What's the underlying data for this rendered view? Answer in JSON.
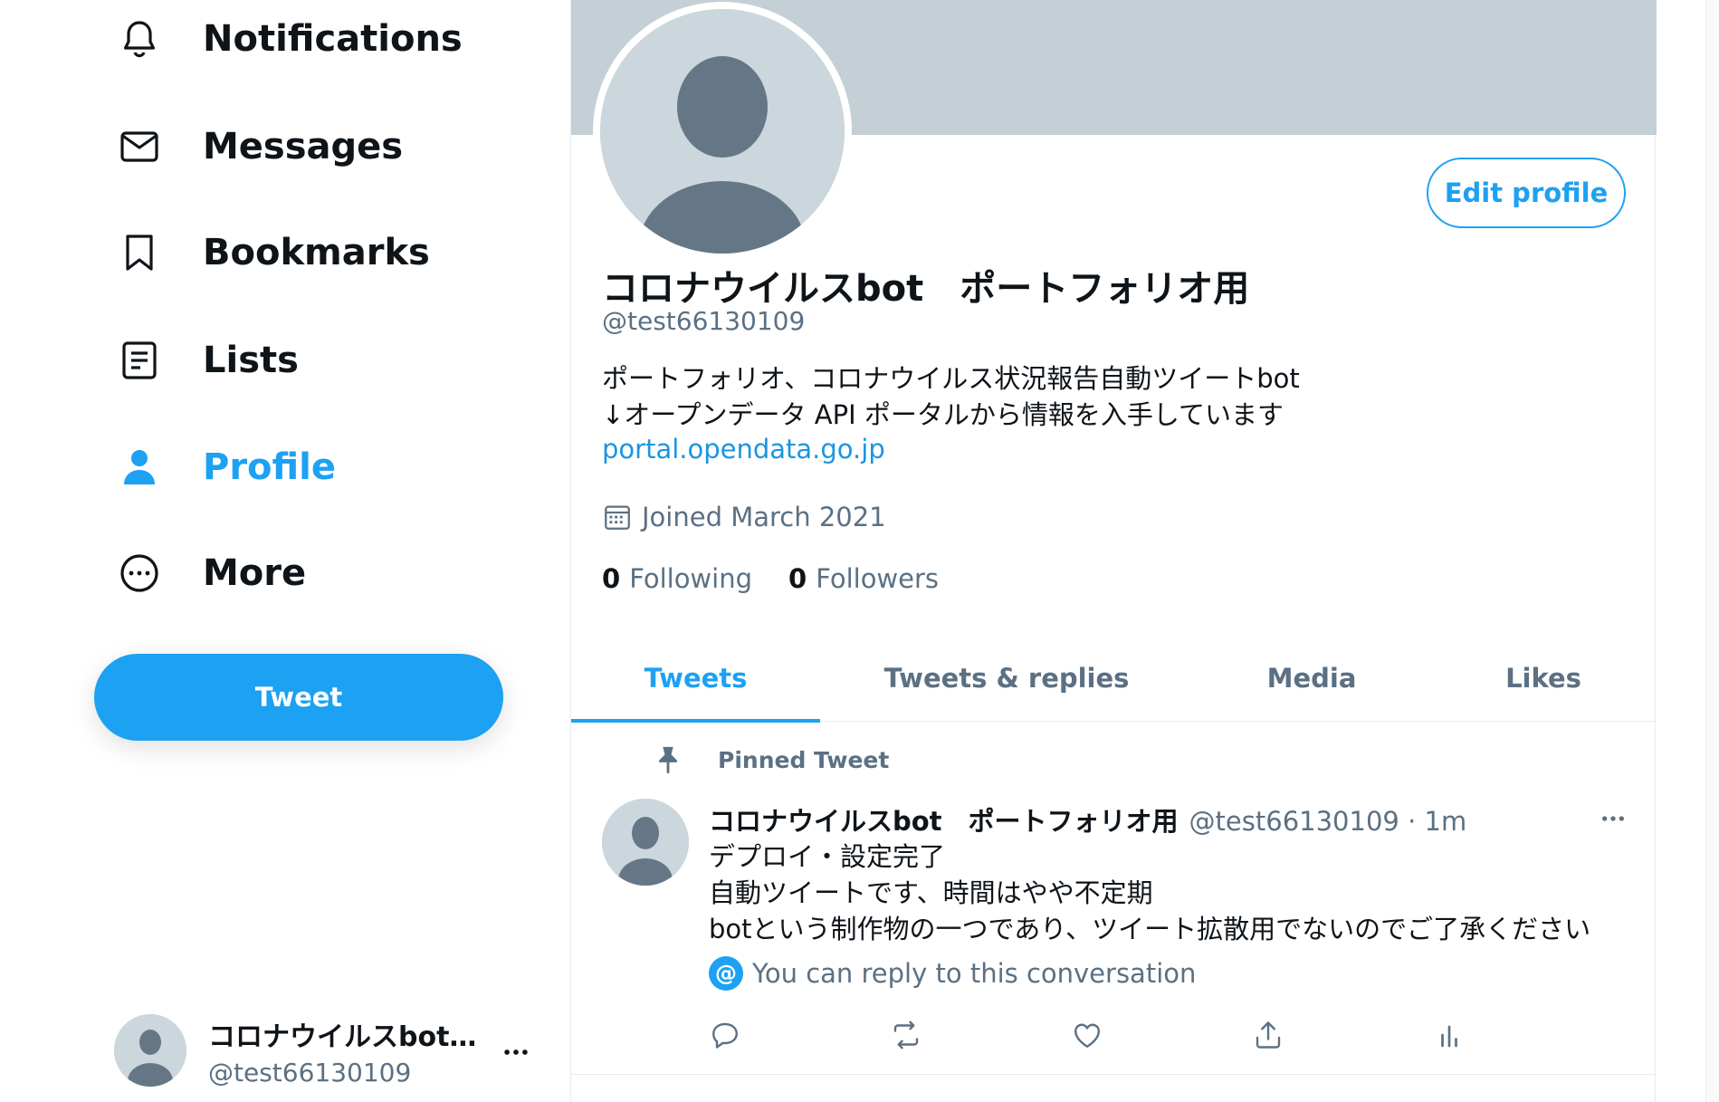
{
  "sidebar": {
    "nav": [
      {
        "label": "Notifications",
        "icon": "bell-icon"
      },
      {
        "label": "Messages",
        "icon": "envelope-icon"
      },
      {
        "label": "Bookmarks",
        "icon": "bookmark-icon"
      },
      {
        "label": "Lists",
        "icon": "list-icon"
      },
      {
        "label": "Profile",
        "icon": "person-icon",
        "active": true
      },
      {
        "label": "More",
        "icon": "more-circle-icon"
      }
    ],
    "tweet_button": "Tweet",
    "account": {
      "name": "コロナウイルスbot…",
      "handle": "@test66130109"
    }
  },
  "profile": {
    "edit_button": "Edit profile",
    "display_name": "コロナウイルスbot　ポートフォリオ用",
    "handle": "@test66130109",
    "bio_line1": "ポートフォリオ、コロナウイルス状況報告自動ツイートbot",
    "bio_line2": "↓オープンデータ API ポータルから情報を入手しています",
    "bio_link": "portal.opendata.go.jp",
    "joined": "Joined March 2021",
    "following_count": "0",
    "following_label": "Following",
    "followers_count": "0",
    "followers_label": "Followers"
  },
  "tabs": [
    {
      "label": "Tweets",
      "active": true
    },
    {
      "label": "Tweets & replies"
    },
    {
      "label": "Media"
    },
    {
      "label": "Likes"
    }
  ],
  "tweet": {
    "pinned_label": "Pinned Tweet",
    "name": "コロナウイルスbot　ポートフォリオ用",
    "handle_time": "@test66130109 · 1m",
    "line1": "デプロイ・設定完了",
    "line2": "自動ツイートです、時間はやや不定期",
    "line3": "botという制作物の一つであり、ツイート拡散用でないのでご了承ください",
    "reply_note": "You can reply to this conversation",
    "reply_badge": "@"
  },
  "colors": {
    "accent": "#1da1f2",
    "banner": "#c4cfd6",
    "secondary_text": "#5b7083"
  }
}
